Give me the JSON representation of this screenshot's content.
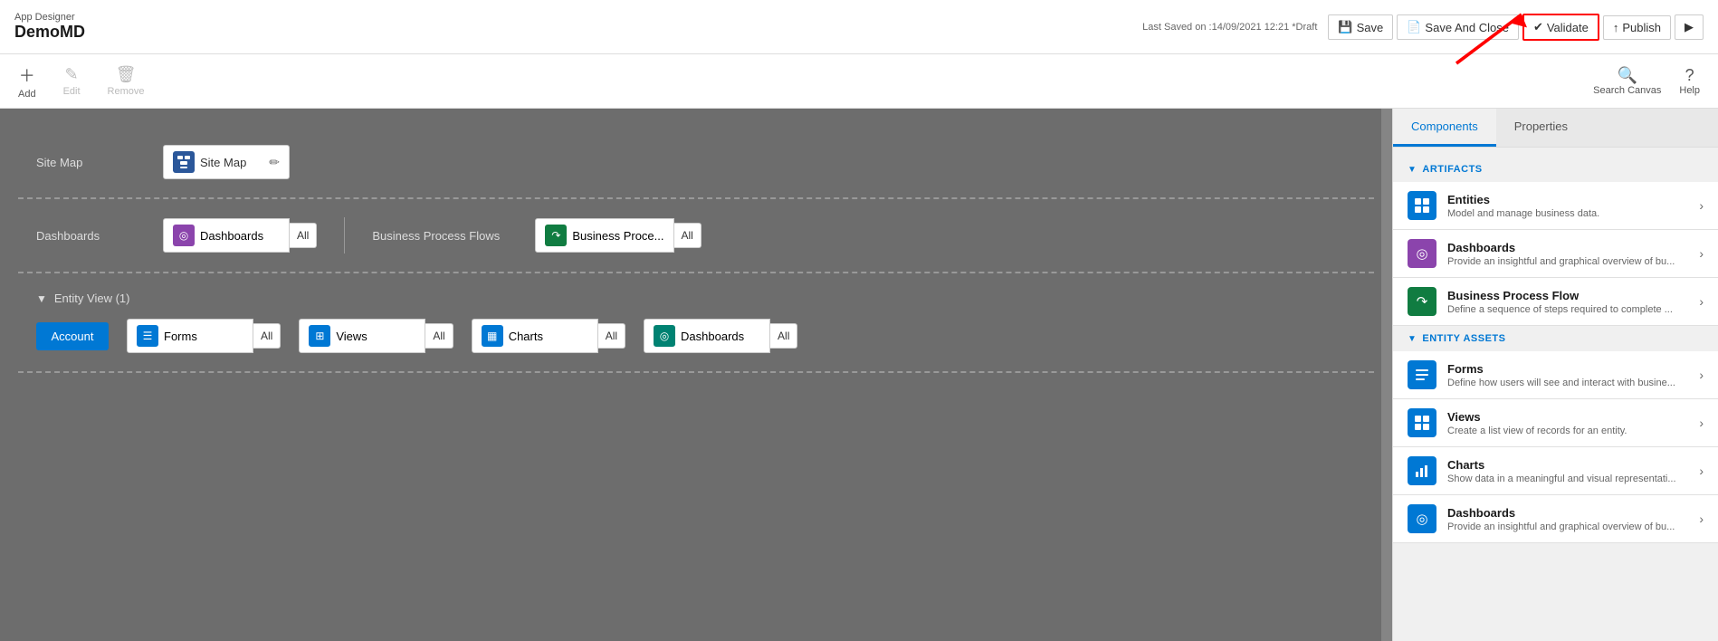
{
  "header": {
    "app_designer_label": "App Designer",
    "app_name": "DemoMD",
    "last_saved": "Last Saved on :14/09/2021 12:21 *Draft",
    "save_label": "Save",
    "save_close_label": "Save And Close",
    "validate_label": "Validate",
    "publish_label": "Publish"
  },
  "toolbar": {
    "add_label": "Add",
    "edit_label": "Edit",
    "remove_label": "Remove",
    "search_canvas_label": "Search Canvas",
    "help_label": "Help"
  },
  "canvas": {
    "sitemap_section": {
      "label": "Site Map",
      "sitemap_box_label": "Site Map"
    },
    "dashboards_section": {
      "label": "Dashboards",
      "dashboards_box_label": "Dashboards",
      "dashboards_all": "All",
      "bpf_label": "Business Process Flows",
      "bpf_box_label": "Business Proce...",
      "bpf_all": "All"
    },
    "entity_view_section": {
      "label": "Entity View (1)",
      "account_btn": "Account",
      "forms_label": "Forms",
      "forms_all": "All",
      "views_label": "Views",
      "views_all": "All",
      "charts_label": "Charts",
      "charts_all": "All",
      "dashboards_label": "Dashboards",
      "dashboards_all": "All"
    }
  },
  "right_panel": {
    "tabs": [
      {
        "label": "Components",
        "active": true
      },
      {
        "label": "Properties",
        "active": false
      }
    ],
    "artifacts_header": "ARTIFACTS",
    "entity_assets_header": "ENTITY ASSETS",
    "artifacts_items": [
      {
        "icon_type": "blue",
        "icon_char": "⊞",
        "title": "Entities",
        "desc": "Model and manage business data."
      },
      {
        "icon_type": "purple",
        "icon_char": "◎",
        "title": "Dashboards",
        "desc": "Provide an insightful and graphical overview of bu..."
      },
      {
        "icon_type": "green",
        "icon_char": "↷",
        "title": "Business Process Flow",
        "desc": "Define a sequence of steps required to complete ..."
      }
    ],
    "entity_assets_items": [
      {
        "icon_type": "blue",
        "icon_char": "☰",
        "title": "Forms",
        "desc": "Define how users will see and interact with busine..."
      },
      {
        "icon_type": "blue",
        "icon_char": "⊞",
        "title": "Views",
        "desc": "Create a list view of records for an entity."
      },
      {
        "icon_type": "blue",
        "icon_char": "▦",
        "title": "Charts",
        "desc": "Show data in a meaningful and visual representati..."
      },
      {
        "icon_type": "blue",
        "icon_char": "◎",
        "title": "Dashboards",
        "desc": "Provide an insightful and graphical overview of bu..."
      }
    ]
  }
}
